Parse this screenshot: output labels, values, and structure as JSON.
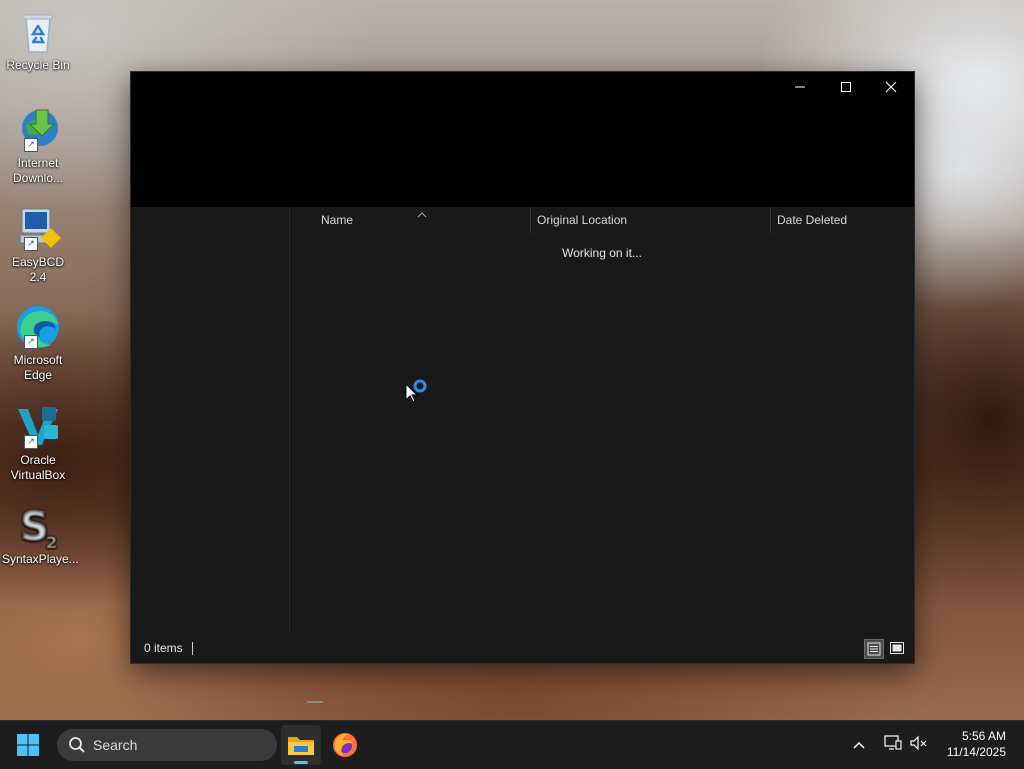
{
  "desktop": {
    "icons": [
      {
        "label": "Recycle Bin",
        "icon": "recycle-bin-icon"
      },
      {
        "label": "Internet Downlo...",
        "icon": "internet-download-manager-icon"
      },
      {
        "label": "EasyBCD 2.4",
        "icon": "easybcd-icon"
      },
      {
        "label": "Microsoft Edge",
        "icon": "edge-icon"
      },
      {
        "label": "Oracle VirtualBox",
        "icon": "virtualbox-icon"
      },
      {
        "label": "SyntaxPlaye...",
        "icon": "syntaxplayer-icon"
      }
    ]
  },
  "window": {
    "controls": {
      "minimize": "minimize-icon",
      "maximize": "maximize-icon",
      "close": "close-icon"
    },
    "columns": [
      "Name",
      "Original Location",
      "Date Deleted"
    ],
    "sort_indicator": "sort-up-chevron-icon",
    "status_message": "Working on it...",
    "status_bar": {
      "item_count": "0 items"
    },
    "view_buttons": {
      "details": "details-view-icon",
      "large_icons": "large-icons-view-icon"
    }
  },
  "taskbar": {
    "start": "windows-start-icon",
    "search": {
      "placeholder": "Search",
      "icon": "search-icon"
    },
    "apps": [
      {
        "name": "File Explorer",
        "icon": "file-explorer-icon",
        "active": true
      },
      {
        "name": "Firefox",
        "icon": "firefox-icon",
        "active": false
      }
    ],
    "tray": {
      "overflow": "chevron-up-icon",
      "network": "network-icon",
      "volume": "volume-muted-icon",
      "time": "5:56 AM",
      "date": "11/14/2025"
    }
  },
  "colors": {
    "accent": "#0078d4",
    "window_bg": "#191919",
    "titlebar_bg": "#000000",
    "taskbar_bg": "#1d1d1d"
  }
}
